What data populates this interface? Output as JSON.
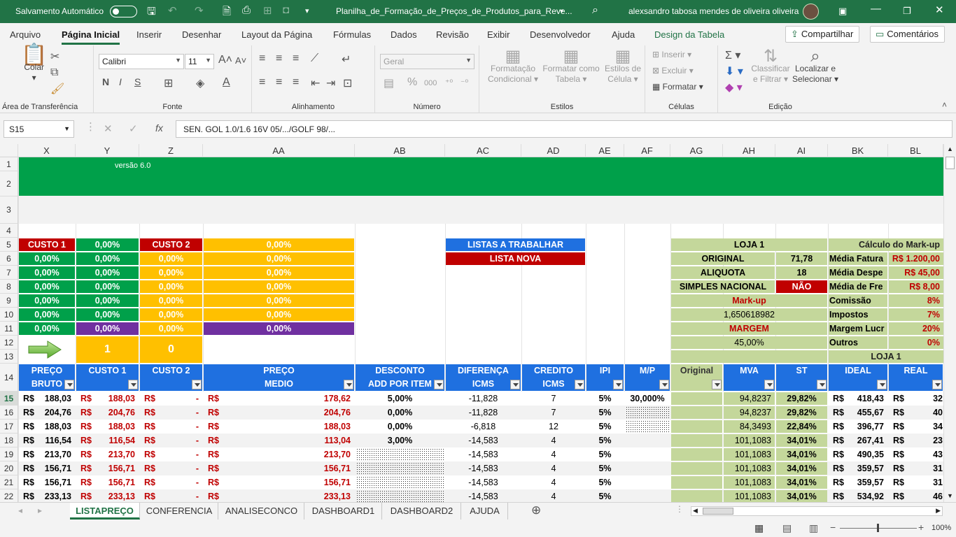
{
  "titlebar": {
    "autosave": "Salvamento Automático",
    "filename": "Planilha_de_Formação_de_Preços_de_Produtos_para_Reve...",
    "user": "alexsandro tabosa mendes de oliveira oliveira"
  },
  "tabs": [
    "Arquivo",
    "Página Inicial",
    "Inserir",
    "Desenhar",
    "Layout da Página",
    "Fórmulas",
    "Dados",
    "Revisão",
    "Exibir",
    "Desenvolvedor",
    "Ajuda",
    "Design da Tabela"
  ],
  "share": "Compartilhar",
  "comments": "Comentários",
  "ribbon": {
    "clipboard": {
      "paste": "Colar",
      "label": "Área de Transferência"
    },
    "font": {
      "name": "Calibri",
      "size": "11",
      "label": "Fonte",
      "bold": "N",
      "italic": "I",
      "underline": "S"
    },
    "align": {
      "label": "Alinhamento"
    },
    "number": {
      "format": "Geral",
      "label": "Número",
      "pct": "%",
      "thousands": "000"
    },
    "styles": {
      "cond": [
        "Formatação",
        "Condicional"
      ],
      "table": [
        "Formatar como",
        "Tabela"
      ],
      "cell": [
        "Estilos de",
        "Célula"
      ],
      "label": "Estilos"
    },
    "cells": {
      "insert": "Inserir",
      "delete": "Excluir",
      "format": "Formatar",
      "label": "Células"
    },
    "edit": {
      "sort": [
        "Classificar",
        "e Filtrar"
      ],
      "find": [
        "Localizar e",
        "Selecionar"
      ],
      "label": "Edição"
    }
  },
  "formula": {
    "namebox": "S15",
    "value": "SEN. GOL 1.0/1.6 16V 05/.../GOLF 98/..."
  },
  "columns": [
    "X",
    "Y",
    "Z",
    "AA",
    "AB",
    "AC",
    "AD",
    "AE",
    "AF",
    "AG",
    "AH",
    "AI",
    "BK",
    "BL"
  ],
  "rows": [
    "1",
    "2",
    "3",
    "4",
    "5",
    "6",
    "7",
    "8",
    "9",
    "10",
    "11",
    "12",
    "13",
    "14",
    "15",
    "16",
    "17",
    "18",
    "19",
    "20",
    "21",
    "22"
  ],
  "sheet": {
    "version": "versão 6.0",
    "custo1": "CUSTO 1",
    "custo2": "CUSTO 2",
    "zero_pct": "0,00%",
    "listas": "LISTAS A TRABALHAR",
    "lista_nova": "LISTA NOVA",
    "arrow_cells": [
      "1",
      "0"
    ],
    "loja_panel": {
      "title": "LOJA 1",
      "original_label": "ORIGINAL",
      "original": "71,78",
      "aliquota_label": "ALIQUOTA",
      "aliquota": "18",
      "simples_label": "SIMPLES NACIONAL",
      "simples": "NÃO",
      "markup_label": "Mark-up",
      "markup": "1,650618982",
      "margem_label": "MARGEM",
      "margem": "45,00%"
    },
    "markup_calc": {
      "title": "Cálculo do Mark-up",
      "rows": [
        [
          "Média Fatura",
          "R$  1.200,00"
        ],
        [
          "Média Despe",
          "R$     45,00"
        ],
        [
          "Média de Fre",
          "R$       8,00"
        ],
        [
          "Comissão",
          "8%"
        ],
        [
          "Impostos",
          "7%"
        ],
        [
          "Margem Lucr",
          "20%"
        ],
        [
          "Outros",
          "0%"
        ]
      ],
      "loja": "LOJA 1"
    },
    "headers": [
      [
        "PREÇO",
        "BRUTO"
      ],
      [
        "CUSTO 1",
        ""
      ],
      [
        "CUSTO 2",
        ""
      ],
      [
        "PREÇO",
        "MEDIO"
      ],
      [
        "DESCONTO",
        "ADD POR ITEM"
      ],
      [
        "DIFERENÇA",
        "ICMS"
      ],
      [
        "CREDITO",
        "ICMS"
      ],
      [
        "IPI",
        ""
      ],
      [
        "M/P",
        ""
      ],
      [
        "Original",
        ""
      ],
      [
        "MVA",
        ""
      ],
      [
        "ST",
        ""
      ],
      [
        "IDEAL",
        ""
      ],
      [
        "REAL",
        ""
      ]
    ],
    "data": [
      [
        "R$",
        "188,03",
        "R$",
        "188,03",
        "R$",
        "-",
        "R$",
        "178,62",
        "5,00%",
        "-11,828",
        "7",
        "5%",
        "30,000%",
        "",
        "94,8237",
        "29,82%",
        "R$",
        "418,43",
        "R$",
        "32"
      ],
      [
        "R$",
        "204,76",
        "R$",
        "204,76",
        "R$",
        "-",
        "R$",
        "204,76",
        "0,00%",
        "-11,828",
        "7",
        "5%",
        "",
        "",
        "94,8237",
        "29,82%",
        "R$",
        "455,67",
        "R$",
        "40"
      ],
      [
        "R$",
        "188,03",
        "R$",
        "188,03",
        "R$",
        "-",
        "R$",
        "188,03",
        "0,00%",
        "-6,818",
        "12",
        "5%",
        "",
        "",
        "84,3493",
        "22,84%",
        "R$",
        "396,77",
        "R$",
        "34"
      ],
      [
        "R$",
        "116,54",
        "R$",
        "116,54",
        "R$",
        "-",
        "R$",
        "113,04",
        "3,00%",
        "-14,583",
        "4",
        "5%",
        "",
        "",
        "101,1083",
        "34,01%",
        "R$",
        "267,41",
        "R$",
        "23"
      ],
      [
        "R$",
        "213,70",
        "R$",
        "213,70",
        "R$",
        "-",
        "R$",
        "213,70",
        "",
        "-14,583",
        "4",
        "5%",
        "",
        "",
        "101,1083",
        "34,01%",
        "R$",
        "490,35",
        "R$",
        "43"
      ],
      [
        "R$",
        "156,71",
        "R$",
        "156,71",
        "R$",
        "-",
        "R$",
        "156,71",
        "",
        "-14,583",
        "4",
        "5%",
        "",
        "",
        "101,1083",
        "34,01%",
        "R$",
        "359,57",
        "R$",
        "31"
      ],
      [
        "R$",
        "156,71",
        "R$",
        "156,71",
        "R$",
        "-",
        "R$",
        "156,71",
        "",
        "-14,583",
        "4",
        "5%",
        "",
        "",
        "101,1083",
        "34,01%",
        "R$",
        "359,57",
        "R$",
        "31"
      ],
      [
        "R$",
        "233,13",
        "R$",
        "233,13",
        "R$",
        "-",
        "R$",
        "233,13",
        "",
        "-14,583",
        "4",
        "5%",
        "",
        "",
        "101,1083",
        "34,01%",
        "R$",
        "534,92",
        "R$",
        "46"
      ]
    ]
  },
  "sheet_tabs": [
    "LISTAPREÇO",
    "CONFERENCIA",
    "ANALISECONCO",
    "DASHBOARD1",
    "DASHBOARD2",
    "AJUDA"
  ],
  "status": {
    "zoom": "100%"
  },
  "colors": {
    "excel_green": "#217346",
    "green": "#00a04a",
    "red": "#c00000",
    "yellow": "#ffc000",
    "purple": "#7030a0",
    "blue": "#1f70e0",
    "sage": "#c4d79b"
  }
}
